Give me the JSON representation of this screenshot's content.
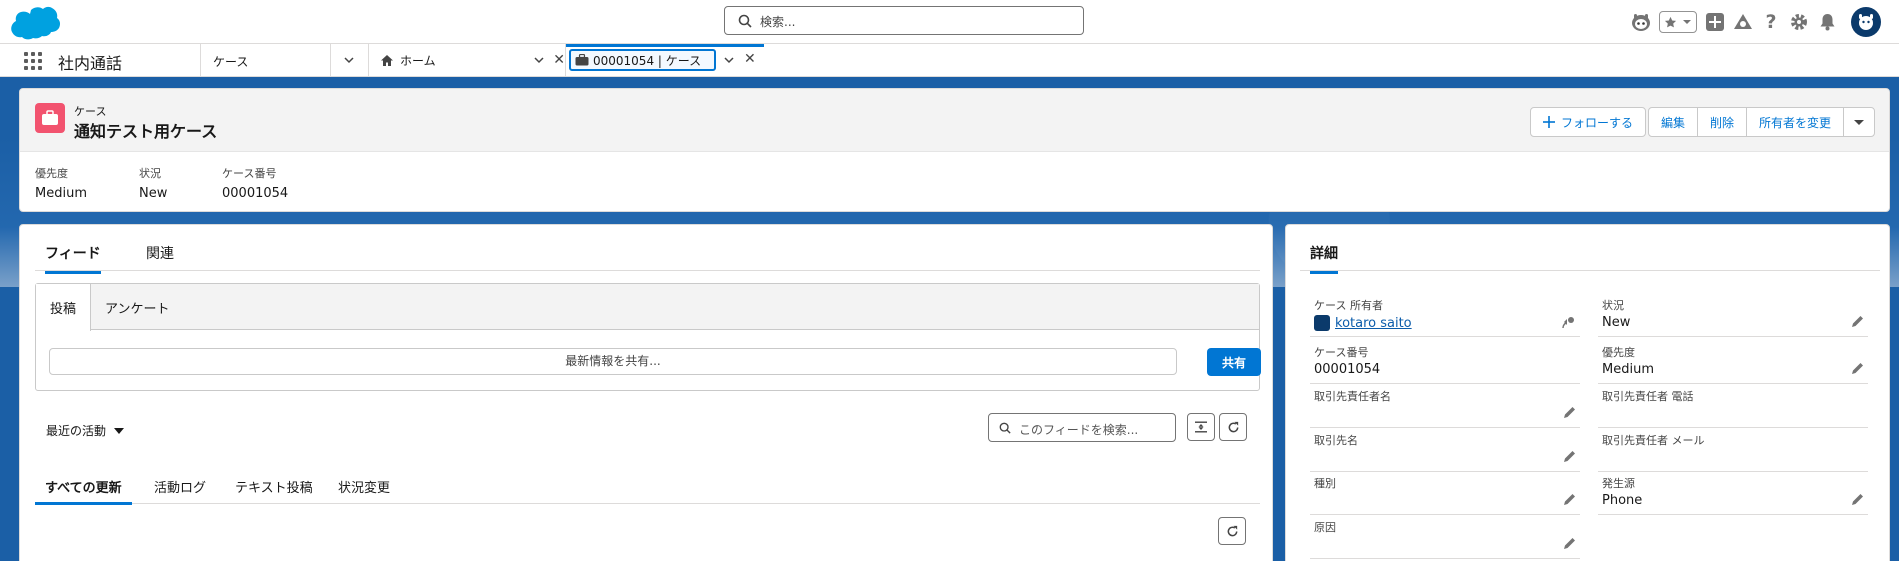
{
  "header": {
    "search_placeholder": "検索..."
  },
  "nav": {
    "app_name": "社内通話",
    "object_label": "ケース",
    "tabs": [
      {
        "label": "ホーム"
      },
      {
        "label": "00001054 | ケース"
      }
    ]
  },
  "record": {
    "type_label": "ケース",
    "title": "通知テスト用ケース",
    "actions": {
      "follow": "フォローする",
      "edit": "編集",
      "delete": "削除",
      "change_owner": "所有者を変更"
    },
    "highlights": [
      {
        "label": "優先度",
        "value": "Medium"
      },
      {
        "label": "状況",
        "value": "New"
      },
      {
        "label": "ケース番号",
        "value": "00001054"
      }
    ]
  },
  "feed": {
    "tabs": [
      "フィード",
      "関連"
    ],
    "publisher_tabs": [
      "投稿",
      "アンケート"
    ],
    "share_placeholder": "最新情報を共有...",
    "share_button": "共有",
    "sort_label": "最近の活動",
    "search_placeholder": "このフィードを検索...",
    "filter_tabs": [
      "すべての更新",
      "活動ログ",
      "テキスト投稿",
      "状況変更"
    ]
  },
  "detail": {
    "tab": "詳細",
    "fields": [
      {
        "label": "ケース 所有者",
        "value": "kotaro saito"
      },
      {
        "label": "状況",
        "value": "New"
      },
      {
        "label": "ケース番号",
        "value": "00001054"
      },
      {
        "label": "優先度",
        "value": "Medium"
      },
      {
        "label": "取引先責任者名",
        "value": ""
      },
      {
        "label": "取引先責任者 電話",
        "value": ""
      },
      {
        "label": "取引先名",
        "value": ""
      },
      {
        "label": "取引先責任者 メール",
        "value": ""
      },
      {
        "label": "種別",
        "value": ""
      },
      {
        "label": "発生源",
        "value": "Phone"
      },
      {
        "label": "原因",
        "value": ""
      }
    ]
  },
  "colors": {
    "brand": "#0176d3",
    "case_icon": "#f2536f",
    "background": "#1b5fa6"
  },
  "icons": [
    "salesforce-logo",
    "search-icon",
    "astro-icon",
    "favorites-star-icon",
    "add-icon",
    "trailhead-icon",
    "help-icon",
    "setup-gear-icon",
    "notification-bell-icon",
    "user-avatar",
    "app-launcher-icon",
    "home-icon",
    "briefcase-icon",
    "close-icon",
    "chevron-down-icon",
    "plus-icon",
    "refresh-icon",
    "collapse-icon",
    "edit-pencil-icon",
    "change-owner-icon"
  ]
}
